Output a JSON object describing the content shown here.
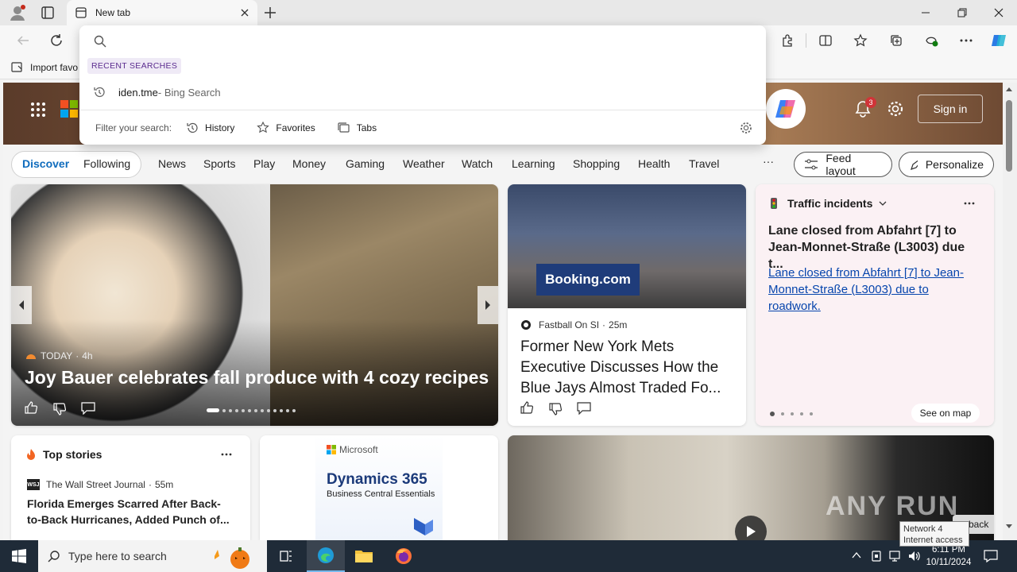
{
  "browser": {
    "tab_title": "New tab",
    "favorites_bar": {
      "import_label": "Import favo"
    }
  },
  "omnibox": {
    "search_value": "",
    "recent_label": "RECENT SEARCHES",
    "recent_items": [
      {
        "query": "iden.tme",
        "source": " - Bing Search"
      }
    ],
    "filter_label": "Filter your search:",
    "filters": [
      "History",
      "Favorites",
      "Tabs"
    ]
  },
  "header": {
    "notifications_count": "3",
    "signin_label": "Sign in"
  },
  "nav": {
    "toggle": [
      "Discover",
      "Following"
    ],
    "items": [
      "News",
      "Sports",
      "Play",
      "Money",
      "Gaming",
      "Weather",
      "Watch",
      "Learning",
      "Shopping",
      "Health",
      "Travel"
    ],
    "more": "···",
    "feed_layout": "Feed layout",
    "personalize": "Personalize"
  },
  "hero_card": {
    "source": "TODAY",
    "time": "4h",
    "headline": "Joy Bauer celebrates fall produce with 4 cozy recipes"
  },
  "mets_card": {
    "sign_text": "Booking.com",
    "source": "Fastball On SI",
    "time": "25m",
    "headline": "Former New York Mets Executive Discusses How the Blue Jays Almost Traded Fo..."
  },
  "traffic_card": {
    "title": "Traffic incidents",
    "headline": "Lane closed from Abfahrt [7] to Jean-Monnet-Straße (L3003) due t...",
    "link": "Lane closed from Abfahrt [7] to Jean-Monnet-Straße (L3003) due to roadwork.",
    "see_map": "See on map"
  },
  "top_stories": {
    "title": "Top stories",
    "source": "The Wall Street Journal",
    "time": "55m",
    "headline": "Florida Emerges Scarred After Back-to-Back Hurricanes, Added Punch of..."
  },
  "ad_card": {
    "brand": "Microsoft",
    "product": "Dynamics 365",
    "subtitle": "Business Central Essentials"
  },
  "video_card": {
    "watermark": "ANY RUN",
    "feedback": "back"
  },
  "taskbar": {
    "search_placeholder": "Type here to search",
    "time": "6:11 PM",
    "date": "10/11/2024",
    "tooltip": [
      "Network  4",
      "Internet access"
    ]
  }
}
